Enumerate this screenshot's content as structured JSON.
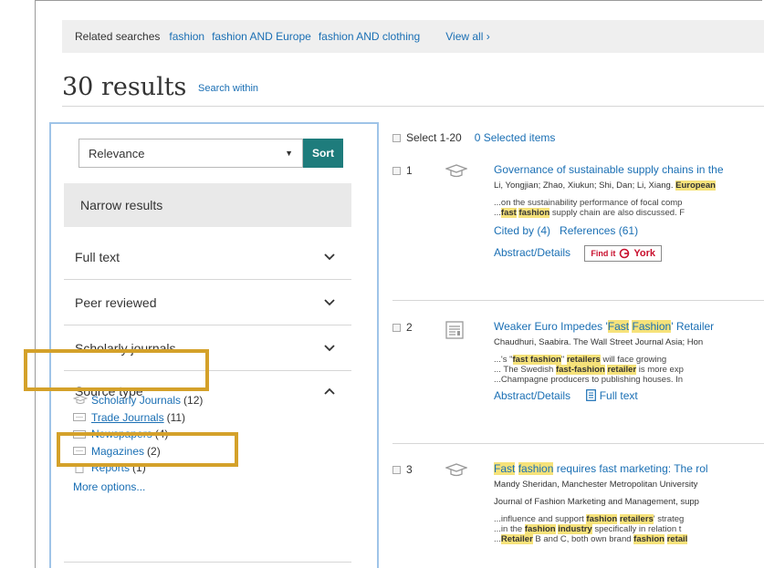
{
  "related": {
    "label": "Related searches",
    "links": [
      "fashion",
      "fashion AND Europe",
      "fashion AND clothing"
    ],
    "view_all": "View all ›"
  },
  "results_header": {
    "title": "30 results",
    "search_within": "Search within"
  },
  "sort": {
    "selected": "Relevance",
    "button": "Sort"
  },
  "narrow": {
    "title": "Narrow results",
    "facets": [
      {
        "label": "Full text",
        "expanded": false
      },
      {
        "label": "Peer reviewed",
        "expanded": false
      },
      {
        "label": "Scholarly journals",
        "expanded": false
      },
      {
        "label": "Source type",
        "expanded": true
      }
    ],
    "source_types": [
      {
        "label": "Scholarly Journals",
        "count": "(12)",
        "icon": "cap-icon"
      },
      {
        "label": "Trade Journals",
        "count": "(11)",
        "icon": "journal-icon"
      },
      {
        "label": "Newspapers",
        "count": "(4)",
        "icon": "journal-icon"
      },
      {
        "label": "Magazines",
        "count": "(2)",
        "icon": "journal-icon"
      },
      {
        "label": "Reports",
        "count": "(1)",
        "icon": "document-icon"
      }
    ],
    "more_options": "More options..."
  },
  "select_bar": {
    "label": "Select 1-20",
    "selected": "0 Selected items"
  },
  "results": [
    {
      "num": "1",
      "title": "Governance of sustainable supply chains in the",
      "authors": "Li, Yongjian; Zhao, Xiukun; Shi, Dan; Li, Xiang.",
      "journal": "European",
      "snippet1": "...on the sustainability performance of focal comp",
      "snippet2a": "fast",
      "snippet2b": "fashion",
      "snippet2c": " supply chain are also discussed. F",
      "cited": "Cited by (4)",
      "refs": "References (61)",
      "abstract": "Abstract/Details",
      "findit": "Find it",
      "york": "York"
    },
    {
      "num": "2",
      "title_a": "Weaker Euro Impedes '",
      "title_b": "Fast",
      "title_c": "Fashion",
      "title_d": "' Retailer",
      "meta": "Chaudhuri, Saabira. The Wall Street Journal Asia; Hon",
      "s1a": "...'s \"",
      "s1b": "fast fashion",
      "s1c": "\" ",
      "s1d": "retailers",
      "s1e": " will face growing",
      "s2a": "... The Swedish ",
      "s2b": "fast-fashion",
      "s2c": " ",
      "s2d": "retailer",
      "s2e": " is more exp",
      "s3": "...Champagne producers to publishing houses. In",
      "abstract": "Abstract/Details",
      "fulltext": "Full text"
    },
    {
      "num": "3",
      "title_a": "Fast",
      "title_b": "fashion",
      "title_c": " requires fast marketing: The rol",
      "meta1": "Mandy Sheridan, Manchester Metropolitan University",
      "meta2": "Journal of Fashion Marketing and Management, supp",
      "s1a": "...influence and support ",
      "s1b": "fashion",
      "s1c": " ",
      "s1d": "retailers",
      "s1e": "' strateg",
      "s2a": "...in the ",
      "s2b": "fashion",
      "s2c": " ",
      "s2d": "industry",
      "s2e": " specifically in relation t",
      "s3a": "...",
      "s3b": "Retailer",
      "s3c": " B and C, both own brand ",
      "s3d": "fashion",
      "s3e": " ",
      "s3f": "retail"
    }
  ],
  "colors": {
    "link": "#1a6fb4",
    "sort_button": "#1e7c7c",
    "highlight": "#f6e27a",
    "callout": "#d4a12a",
    "sidebar_border": "#9fc4e8"
  }
}
